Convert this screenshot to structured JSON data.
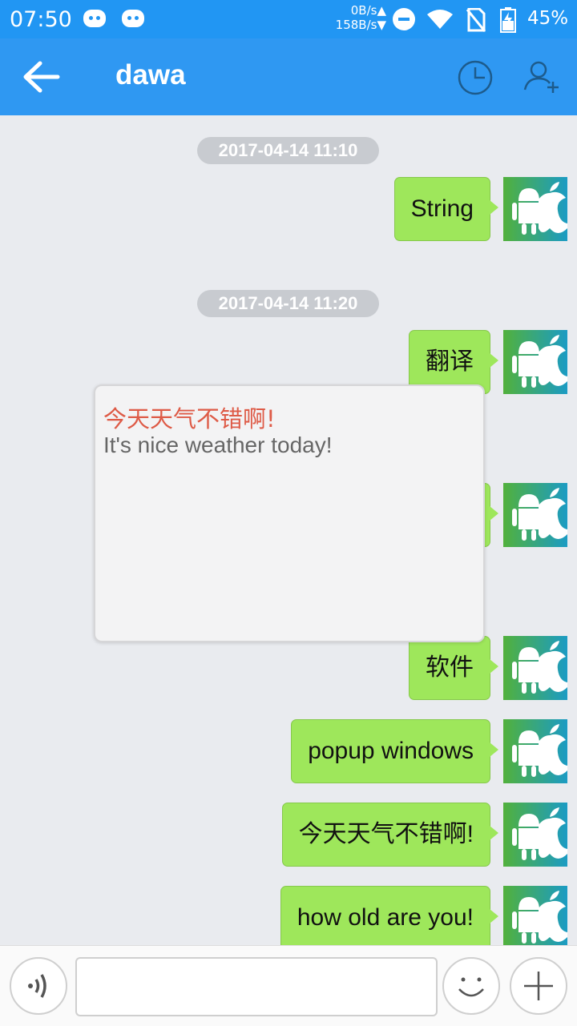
{
  "status_bar": {
    "time": "07:50",
    "up_speed": "0B/s▲",
    "down_speed": "158B/s▼",
    "battery": "45%"
  },
  "header": {
    "title": "dawa",
    "back_icon": "back-arrow-icon",
    "history_icon": "clock-icon",
    "add_icon": "add-user-icon"
  },
  "chat": {
    "timestamps": [
      "2017-04-14 11:10",
      "2017-04-14 11:20"
    ],
    "messages": [
      {
        "text": "String"
      },
      {
        "text": "翻译"
      },
      {
        "text": ""
      },
      {
        "text": "软件"
      },
      {
        "text": "popup windows"
      },
      {
        "text": "今天天气不错啊!"
      },
      {
        "text": "how old are you!"
      }
    ]
  },
  "popup": {
    "chinese": "今天天气不错啊!",
    "english": "It's nice weather today!"
  },
  "input_bar": {
    "value": "",
    "voice_icon": "voice-icon",
    "emoji_icon": "emoji-icon",
    "plus_icon": "plus-icon"
  },
  "colors": {
    "accent": "#2f98f2",
    "bubble": "#9ee75b",
    "popup_cn": "#de5b47"
  }
}
